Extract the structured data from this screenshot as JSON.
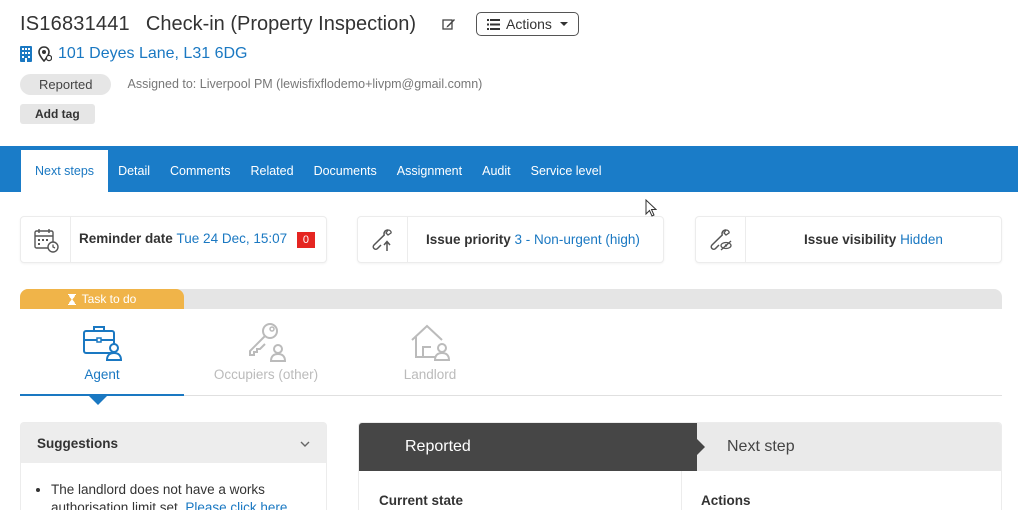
{
  "header": {
    "issue_id": "IS16831441",
    "title": "Check-in (Property Inspection)",
    "actions_label": "Actions",
    "address": "101 Deyes Lane, L31 6DG",
    "status": "Reported",
    "assigned": "Assigned to: Liverpool PM (lewisfixflodemo+livpm@gmail.comn)",
    "add_tag": "Add tag"
  },
  "tabs": [
    {
      "label": "Next steps",
      "active": true
    },
    {
      "label": "Detail"
    },
    {
      "label": "Comments"
    },
    {
      "label": "Related"
    },
    {
      "label": "Documents"
    },
    {
      "label": "Assignment"
    },
    {
      "label": "Audit"
    },
    {
      "label": "Service level"
    }
  ],
  "cards": {
    "reminder": {
      "label": "Reminder date",
      "value": "Tue 24 Dec, 15:07",
      "count": "0"
    },
    "priority": {
      "label": "Issue priority",
      "value": "3 - Non-urgent (high)"
    },
    "visibility": {
      "label": "Issue visibility",
      "value": "Hidden"
    }
  },
  "task": {
    "label": "Task to do"
  },
  "roles": [
    {
      "label": "Agent",
      "active": true
    },
    {
      "label": "Occupiers (other)"
    },
    {
      "label": "Landlord"
    }
  ],
  "suggestions": {
    "title": "Suggestions",
    "item_text": "The landlord does not have a works authorisation limit set.",
    "item_link": "Please click here"
  },
  "workflow": {
    "current": "Reported",
    "next": "Next step",
    "col_left": "Current state",
    "col_right": "Actions"
  },
  "colors": {
    "accent": "#1a7cc8",
    "link": "#1a78c2",
    "task": "#f0b449",
    "alert": "#e52521"
  }
}
